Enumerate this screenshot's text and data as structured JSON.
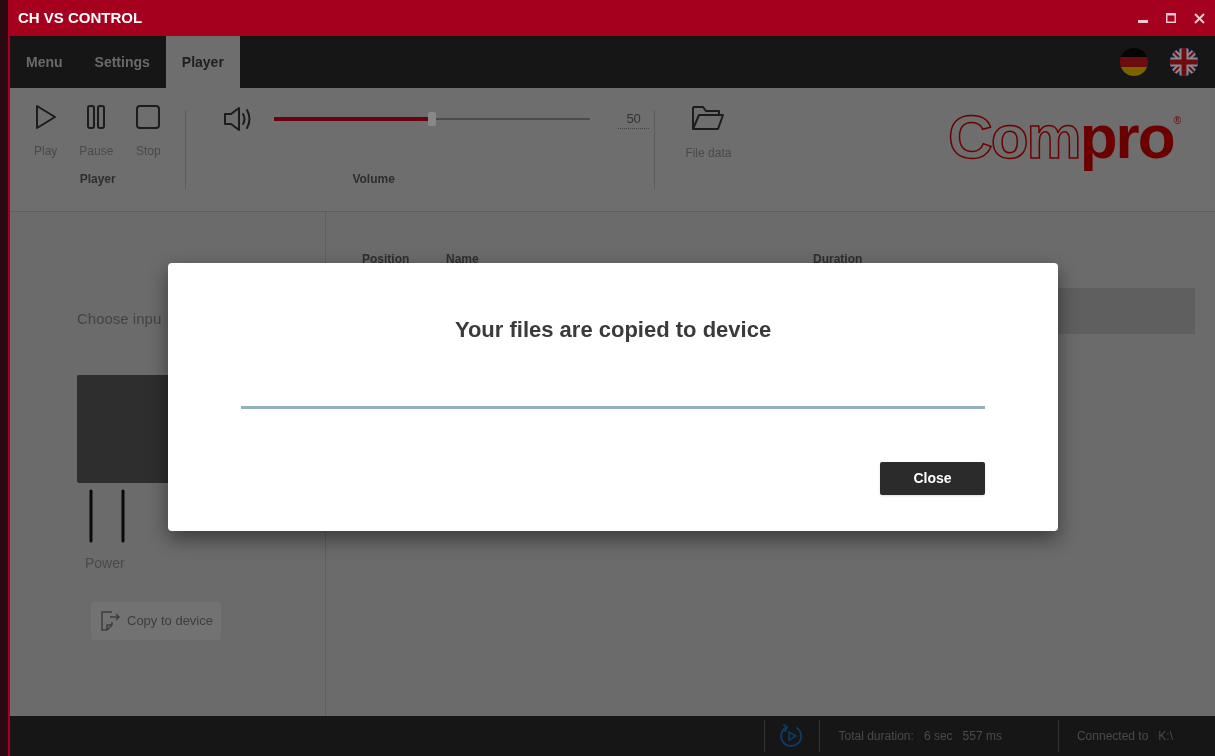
{
  "window": {
    "title": "CH VS CONTROL"
  },
  "tabs": [
    {
      "label": "Menu",
      "selected": false
    },
    {
      "label": "Settings",
      "selected": false
    },
    {
      "label": "Player",
      "selected": true
    }
  ],
  "toolbar": {
    "player_group": {
      "label": "Player",
      "buttons": [
        {
          "kind": "play",
          "label": "Play"
        },
        {
          "kind": "pause",
          "label": "Pause"
        },
        {
          "kind": "stop",
          "label": "Stop"
        }
      ]
    },
    "volume_group": {
      "label": "Volume",
      "level": 0.5,
      "reading": "50"
    },
    "file_button": {
      "label": "File data"
    },
    "logo": {
      "outline_part": "Com",
      "solid_part": "pro",
      "mark": "®"
    }
  },
  "left_panel": {
    "heading": "Choose inpu",
    "connector_label": "Power",
    "copy_button": {
      "label": "Copy to device",
      "disabled": true
    }
  },
  "table": {
    "columns": [
      "Position",
      "Name",
      "Duration"
    ]
  },
  "dialog": {
    "title": "Your files are copied to device",
    "level": 1,
    "button": "Close"
  },
  "status_bar": {
    "total_label": "Total duration:",
    "seconds": "6 sec",
    "milliseconds": "557 ms",
    "connected_label": "Connected to",
    "drive": "K:\\"
  }
}
